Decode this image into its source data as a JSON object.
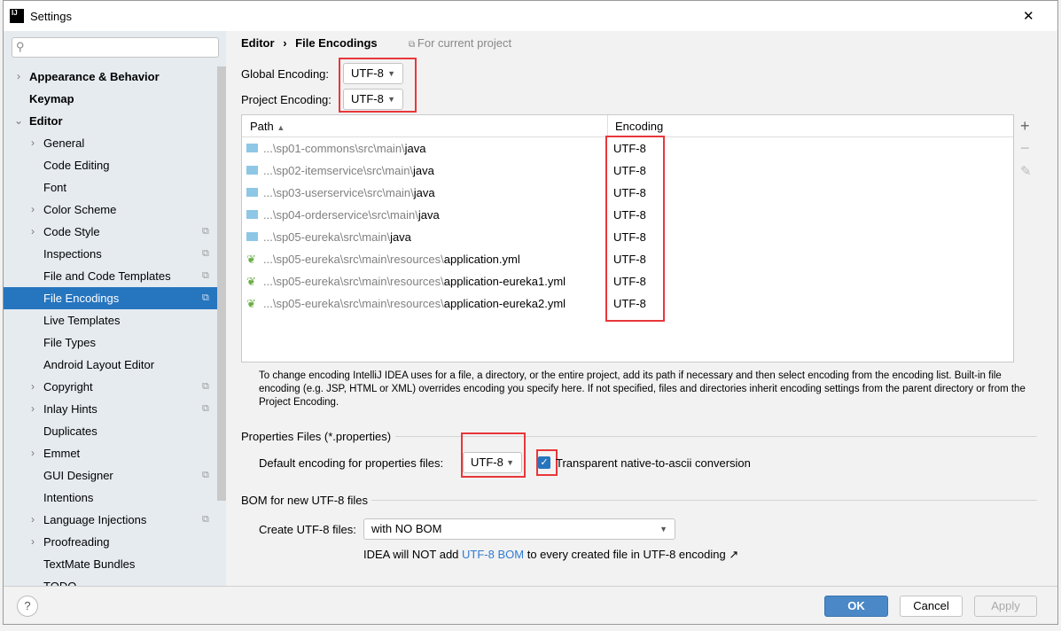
{
  "window": {
    "title": "Settings",
    "close": "✕"
  },
  "sidebar": {
    "items": [
      {
        "label": "Appearance & Behavior",
        "level": 0,
        "bold": true,
        "chevron": "right"
      },
      {
        "label": "Keymap",
        "level": 0,
        "bold": true
      },
      {
        "label": "Editor",
        "level": 0,
        "bold": true,
        "chevron": "down"
      },
      {
        "label": "General",
        "level": 1,
        "chevron": "right"
      },
      {
        "label": "Code Editing",
        "level": 1
      },
      {
        "label": "Font",
        "level": 1
      },
      {
        "label": "Color Scheme",
        "level": 1,
        "chevron": "right"
      },
      {
        "label": "Code Style",
        "level": 1,
        "chevron": "right",
        "project": true
      },
      {
        "label": "Inspections",
        "level": 1,
        "project": true
      },
      {
        "label": "File and Code Templates",
        "level": 1,
        "project": true
      },
      {
        "label": "File Encodings",
        "level": 1,
        "project": true,
        "selected": true
      },
      {
        "label": "Live Templates",
        "level": 1
      },
      {
        "label": "File Types",
        "level": 1
      },
      {
        "label": "Android Layout Editor",
        "level": 1
      },
      {
        "label": "Copyright",
        "level": 1,
        "chevron": "right",
        "project": true
      },
      {
        "label": "Inlay Hints",
        "level": 1,
        "chevron": "right",
        "project": true
      },
      {
        "label": "Duplicates",
        "level": 1
      },
      {
        "label": "Emmet",
        "level": 1,
        "chevron": "right"
      },
      {
        "label": "GUI Designer",
        "level": 1,
        "project": true
      },
      {
        "label": "Intentions",
        "level": 1
      },
      {
        "label": "Language Injections",
        "level": 1,
        "chevron": "right",
        "project": true
      },
      {
        "label": "Proofreading",
        "level": 1,
        "chevron": "right"
      },
      {
        "label": "TextMate Bundles",
        "level": 1
      },
      {
        "label": "TODO",
        "level": 1
      }
    ]
  },
  "breadcrumb": {
    "parent": "Editor",
    "sep": "›",
    "current": "File Encodings",
    "scope": "For current project"
  },
  "global": {
    "label": "Global Encoding:",
    "value": "UTF-8"
  },
  "project": {
    "label": "Project Encoding:",
    "value": "UTF-8"
  },
  "table": {
    "col_path": "Path",
    "col_encoding": "Encoding",
    "rows": [
      {
        "prefix": "...\\sp01-commons\\src\\main\\",
        "name": "java",
        "encoding": "UTF-8",
        "icon": "folder"
      },
      {
        "prefix": "...\\sp02-itemservice\\src\\main\\",
        "name": "java",
        "encoding": "UTF-8",
        "icon": "folder"
      },
      {
        "prefix": "...\\sp03-userservice\\src\\main\\",
        "name": "java",
        "encoding": "UTF-8",
        "icon": "folder"
      },
      {
        "prefix": "...\\sp04-orderservice\\src\\main\\",
        "name": "java",
        "encoding": "UTF-8",
        "icon": "folder"
      },
      {
        "prefix": "...\\sp05-eureka\\src\\main\\",
        "name": "java",
        "encoding": "UTF-8",
        "icon": "folder"
      },
      {
        "prefix": "...\\sp05-eureka\\src\\main\\resources\\",
        "name": "application.yml",
        "encoding": "UTF-8",
        "icon": "spring-yml"
      },
      {
        "prefix": "...\\sp05-eureka\\src\\main\\resources\\",
        "name": "application-eureka1.yml",
        "encoding": "UTF-8",
        "icon": "spring-yml"
      },
      {
        "prefix": "...\\sp05-eureka\\src\\main\\resources\\",
        "name": "application-eureka2.yml",
        "encoding": "UTF-8",
        "icon": "spring-yml"
      }
    ],
    "toolbar": {
      "add": "+",
      "remove": "−",
      "edit": "✎"
    }
  },
  "help_text": "To change encoding IntelliJ IDEA uses for a file, a directory, or the entire project, add its path if necessary and then select encoding from the encoding list. Built-in file encoding (e.g. JSP, HTML or XML) overrides encoding you specify here. If not specified, files and directories inherit encoding settings from the parent directory or from the Project Encoding.",
  "properties": {
    "section": "Properties Files (*.properties)",
    "label": "Default encoding for properties files:",
    "value": "UTF-8",
    "transparent_label": "Transparent native-to-ascii conversion",
    "transparent_checked": true
  },
  "bom": {
    "section": "BOM for new UTF-8 files",
    "label": "Create UTF-8 files:",
    "value": "with NO BOM",
    "note_pre": "IDEA will NOT add ",
    "note_link": "UTF-8 BOM",
    "note_post": " to every created file in UTF-8 encoding ↗"
  },
  "footer": {
    "help": "?",
    "ok": "OK",
    "cancel": "Cancel",
    "apply": "Apply"
  },
  "colors": {
    "accent": "#2675bf",
    "highlight": "#e8373a",
    "link": "#2f7bd1"
  }
}
